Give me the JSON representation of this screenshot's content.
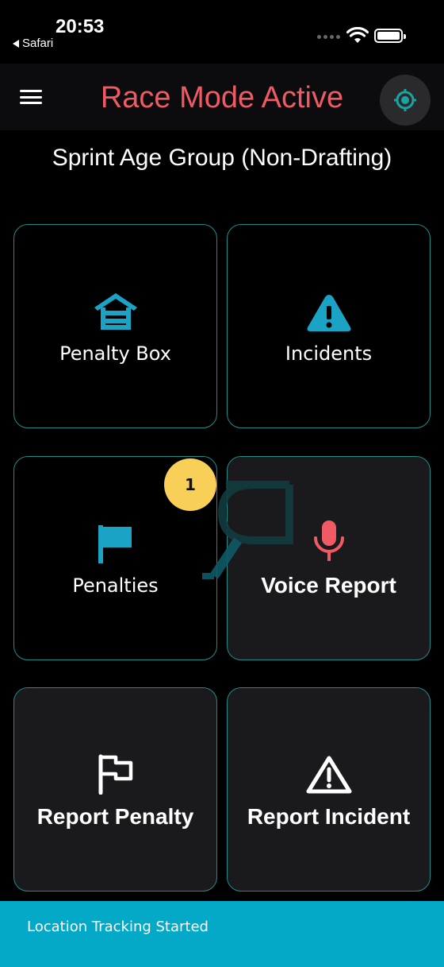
{
  "status_bar": {
    "time": "20:53",
    "back_app": "Safari"
  },
  "header": {
    "title": "Race Mode Active",
    "title_color": "#f05a64",
    "menu_icon": "hamburger-menu-icon",
    "location_icon": "crosshair-location-icon"
  },
  "race": {
    "name": "Sprint Age Group (Non-Drafting)"
  },
  "tiles": [
    {
      "label": "Penalty Box",
      "icon": "penalty-box-icon",
      "icon_color": "#1aa3c4"
    },
    {
      "label": "Incidents",
      "icon": "warning-triangle-icon",
      "icon_color": "#1aa3c4"
    },
    {
      "label": "Penalties",
      "icon": "flag-icon",
      "icon_color": "#1aa3c4",
      "badge": "1"
    },
    {
      "label": "Voice Report",
      "icon": "microphone-icon",
      "icon_color": "#f05a64"
    },
    {
      "label": "Report Penalty",
      "icon": "flag-outline-icon",
      "icon_color": "#ffffff"
    },
    {
      "label": "Report Incident",
      "icon": "warning-outline-icon",
      "icon_color": "#ffffff"
    }
  ],
  "toast": {
    "message": "Location Tracking Started",
    "color": "#03a9c6"
  },
  "badge_color": "#f8cf57",
  "accent_border": "#1f8c8c"
}
